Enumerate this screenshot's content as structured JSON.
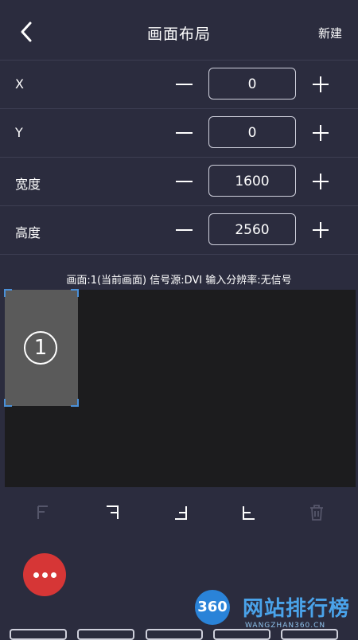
{
  "header": {
    "title": "画面布局",
    "new_label": "新建",
    "back_icon": "chevron-left-icon"
  },
  "fields": [
    {
      "label": "X",
      "value": "0"
    },
    {
      "label": "Y",
      "value": "0"
    },
    {
      "label": "宽度",
      "value": "1600"
    },
    {
      "label": "高度",
      "value": "2560"
    }
  ],
  "info": "画面:1(当前画面)   信号源:DVI  输入分辨率:无信号",
  "canvas": {
    "screen_number": "1",
    "selection_color": "#4a90d9"
  },
  "toolbar": {
    "icons": [
      "align-top-left-icon",
      "align-top-right-icon",
      "align-bottom-right-icon",
      "align-bottom-left-icon",
      "trash-icon"
    ]
  },
  "fab": {
    "icon": "more-dots-icon",
    "color": "#d63636"
  },
  "watermark": {
    "badge": "360",
    "text": "网站排行榜",
    "sub": "WANGZHAN360.CN"
  }
}
